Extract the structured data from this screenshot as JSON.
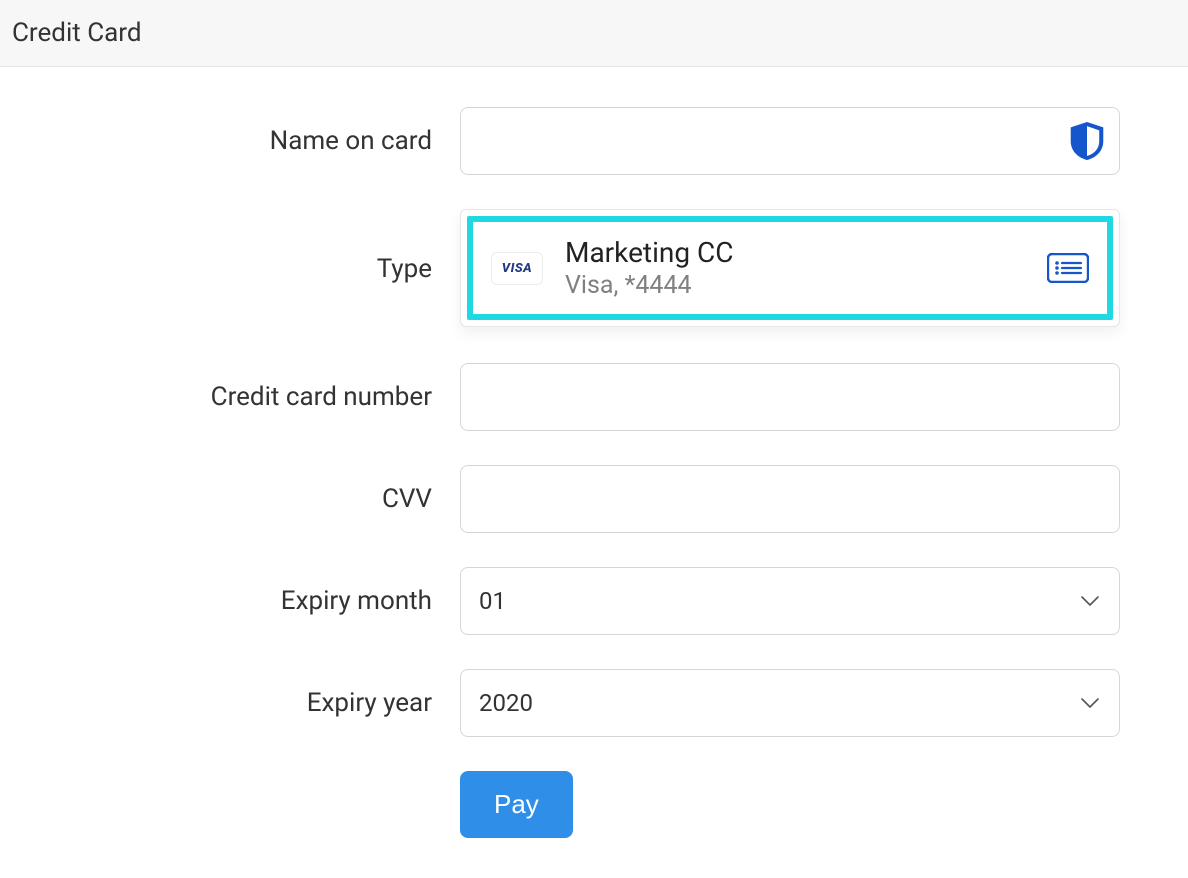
{
  "header": {
    "title": "Credit Card"
  },
  "form": {
    "name_label": "Name on card",
    "name_value": "",
    "type_label": "Type",
    "cc_number_label": "Credit card number",
    "cc_number_value": "",
    "cvv_label": "CVV",
    "cvv_value": "",
    "expiry_month_label": "Expiry month",
    "expiry_month_value": "01",
    "expiry_year_label": "Expiry year",
    "expiry_year_value": "2020",
    "pay_label": "Pay"
  },
  "suggestion": {
    "brand": "VISA",
    "title": "Marketing CC",
    "subtitle": "Visa, *4444"
  },
  "colors": {
    "accent_blue": "#1656cc",
    "highlight_cyan": "#1fd8e2",
    "button_blue": "#2e8ee8"
  }
}
